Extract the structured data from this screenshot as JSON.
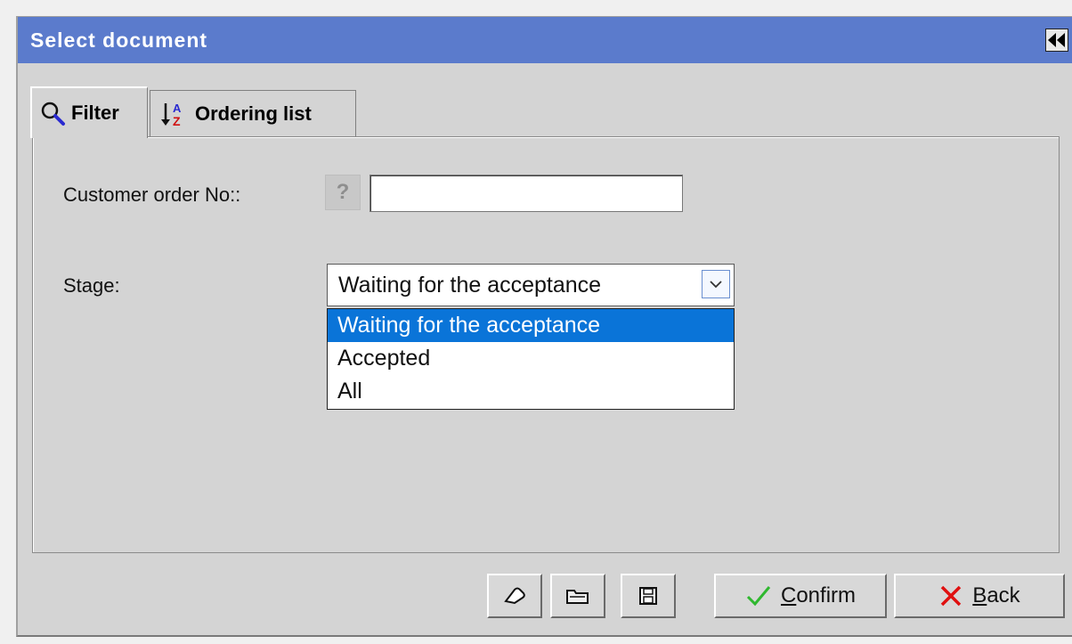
{
  "dialog": {
    "title": "Select document"
  },
  "tabs": [
    {
      "label": "Filter",
      "icon": "magnifier-icon",
      "active": true
    },
    {
      "label": "Ordering list",
      "icon": "sort-az-icon",
      "active": false
    }
  ],
  "filter": {
    "customer_order_label": "Customer order No::",
    "help_label": "?",
    "customer_order_value": "",
    "stage_label": "Stage:",
    "stage_selected": "Waiting for the acceptance",
    "stage_options": [
      "Waiting for the acceptance",
      "Accepted",
      "All"
    ]
  },
  "toolbar": {
    "clear_icon": "eraser-icon",
    "open_icon": "folder-icon",
    "save_icon": "floppy-disk-icon"
  },
  "actions": {
    "confirm_first": "C",
    "confirm_rest": "onfirm",
    "back_first": "B",
    "back_rest": "ack"
  },
  "colors": {
    "titlebar": "#5b7bcc",
    "selected_option": "#0a74d8",
    "confirm_check": "#2fb82f",
    "back_cross": "#e01010"
  }
}
